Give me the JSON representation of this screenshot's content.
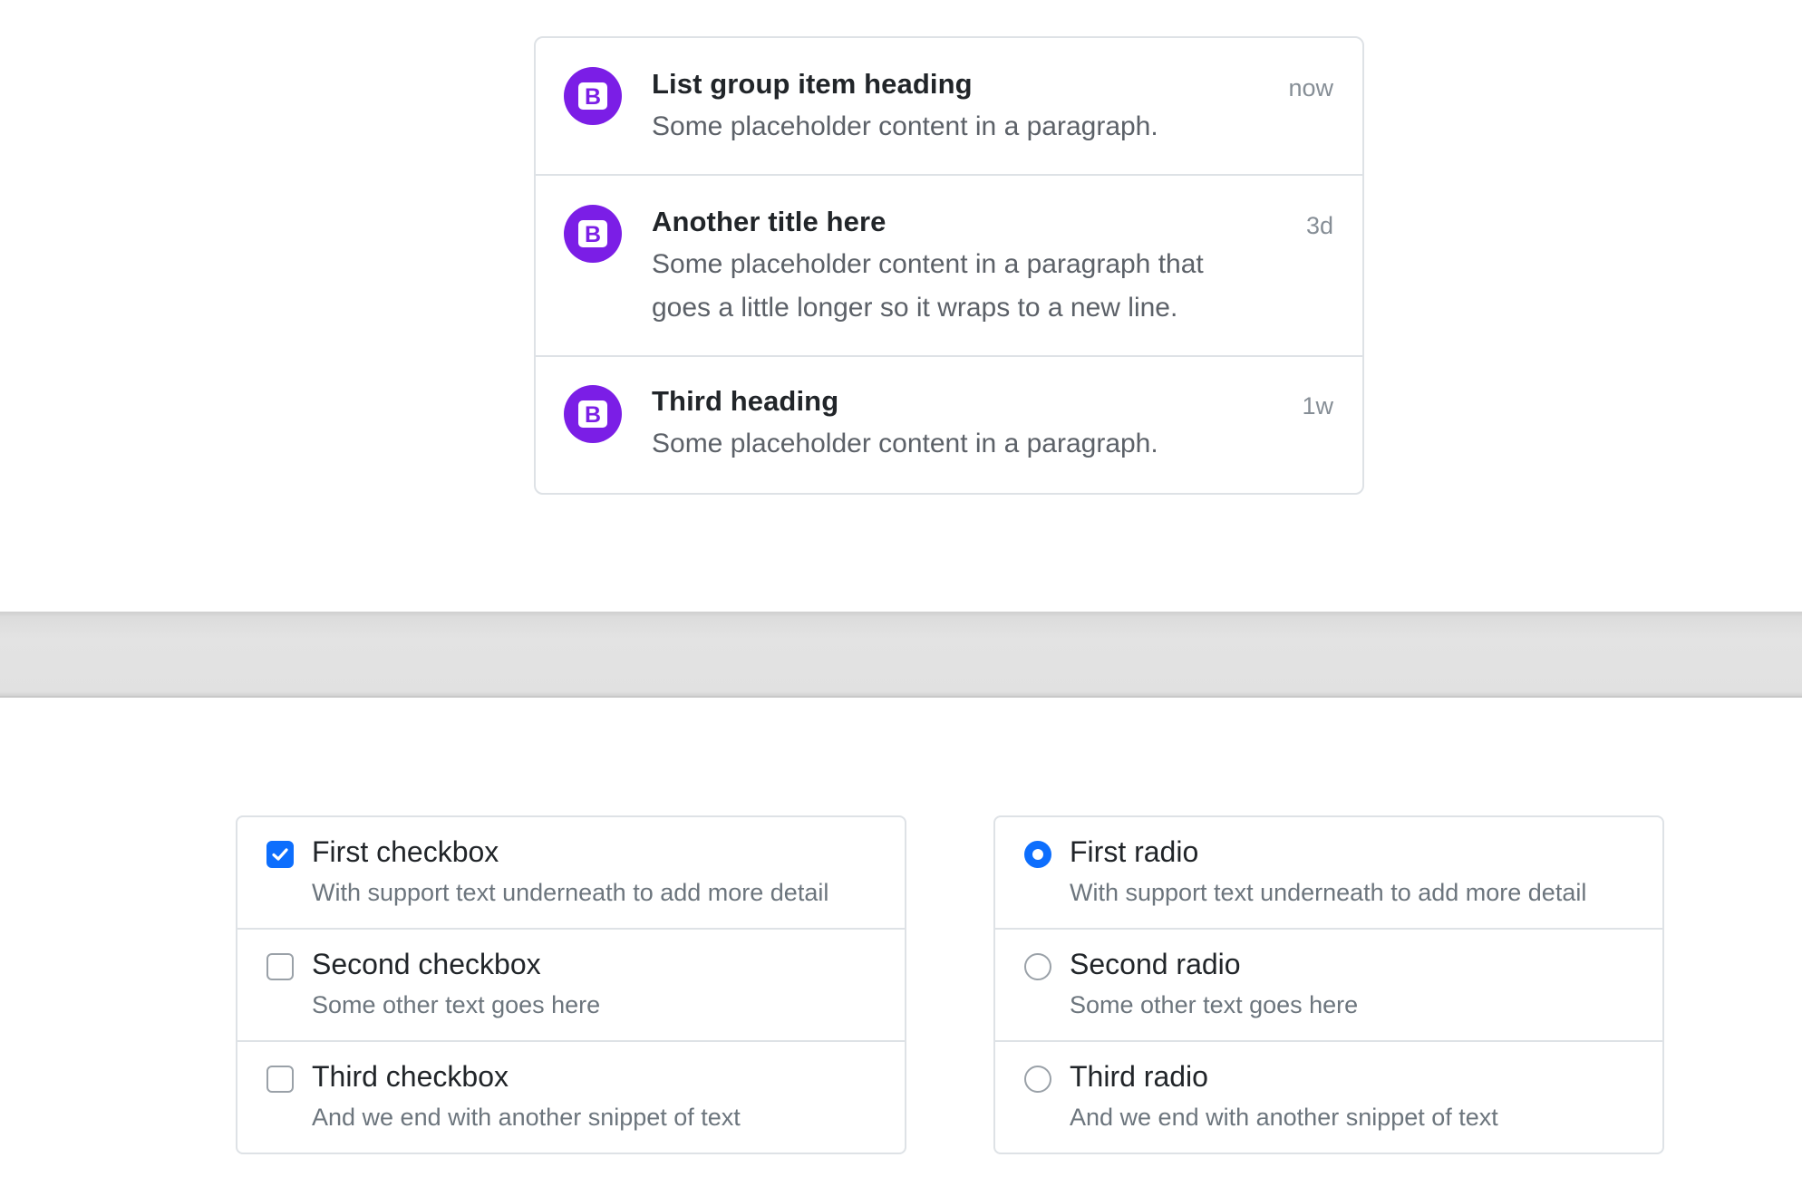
{
  "list_group": {
    "items": [
      {
        "heading": "List group item heading",
        "text": "Some placeholder content in a paragraph.",
        "time": "now",
        "avatar_icon": "bootstrap-logo-icon"
      },
      {
        "heading": "Another title here",
        "text": "Some placeholder content in a paragraph that goes a little longer so it wraps to a new line.",
        "time": "3d",
        "avatar_icon": "bootstrap-logo-icon"
      },
      {
        "heading": "Third heading",
        "text": "Some placeholder content in a paragraph.",
        "time": "1w",
        "avatar_icon": "bootstrap-logo-icon"
      }
    ]
  },
  "checkbox_group": {
    "items": [
      {
        "label": "First checkbox",
        "sub": "With support text underneath to add more detail",
        "checked": true
      },
      {
        "label": "Second checkbox",
        "sub": "Some other text goes here",
        "checked": false
      },
      {
        "label": "Third checkbox",
        "sub": "And we end with another snippet of text",
        "checked": false
      }
    ]
  },
  "radio_group": {
    "items": [
      {
        "label": "First radio",
        "sub": "With support text underneath to add more detail",
        "checked": true
      },
      {
        "label": "Second radio",
        "sub": "Some other text goes here",
        "checked": false
      },
      {
        "label": "Third radio",
        "sub": "And we end with another snippet of text",
        "checked": false
      }
    ]
  },
  "colors": {
    "accent": "#0d6efd",
    "avatar": "#7b1ee6",
    "border": "#dee2e6",
    "muted_text": "#6c757d"
  }
}
